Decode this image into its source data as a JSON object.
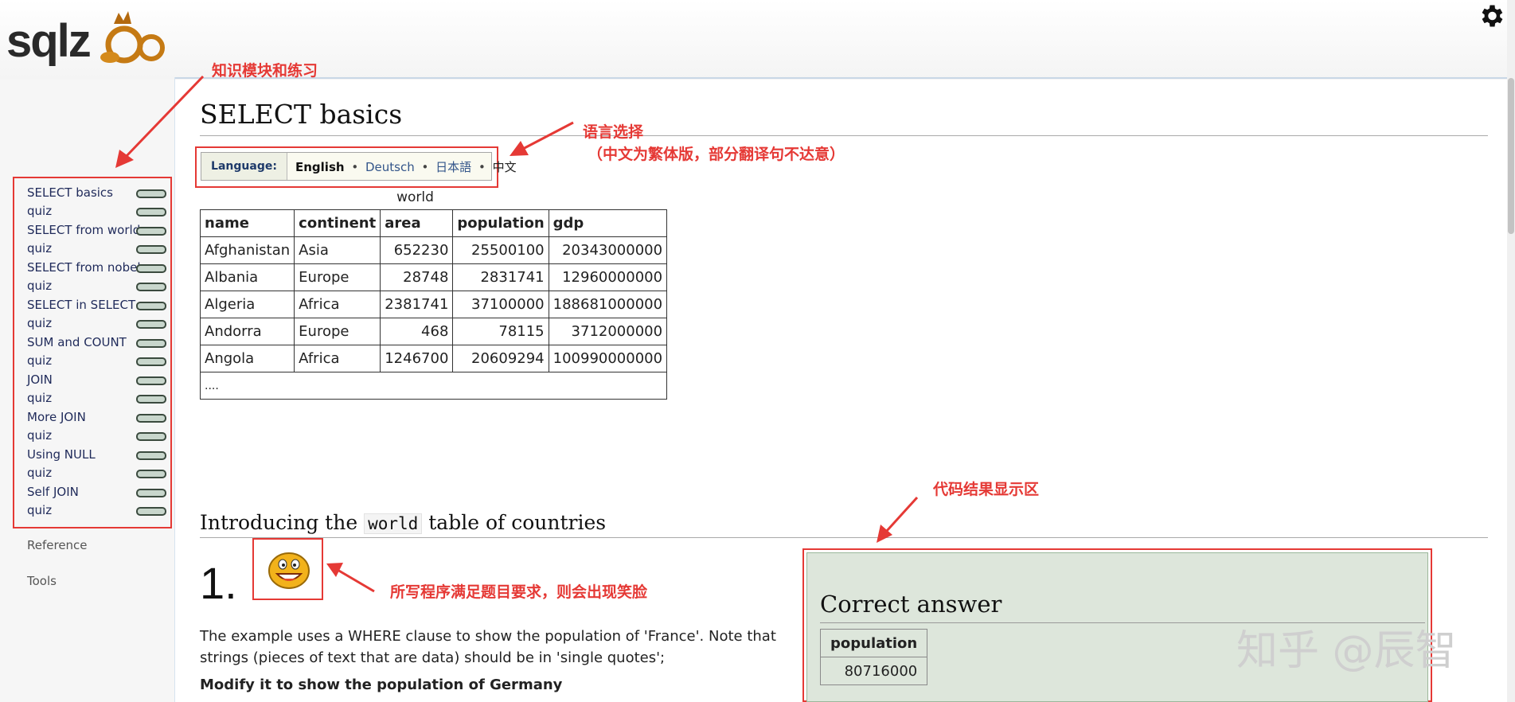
{
  "header": {
    "logo_text": "sqlz",
    "settings_icon": "gear-icon"
  },
  "sidebar": {
    "items": [
      {
        "label": "SELECT basics"
      },
      {
        "label": "quiz"
      },
      {
        "label": "SELECT from world"
      },
      {
        "label": "quiz"
      },
      {
        "label": "SELECT from nobel"
      },
      {
        "label": "quiz"
      },
      {
        "label": "SELECT in SELECT"
      },
      {
        "label": "quiz"
      },
      {
        "label": "SUM and COUNT"
      },
      {
        "label": "quiz"
      },
      {
        "label": "JOIN"
      },
      {
        "label": "quiz"
      },
      {
        "label": "More JOIN"
      },
      {
        "label": "quiz"
      },
      {
        "label": "Using NULL"
      },
      {
        "label": "quiz"
      },
      {
        "label": "Self JOIN"
      },
      {
        "label": "quiz"
      }
    ],
    "reference": "Reference",
    "tools": "Tools"
  },
  "main": {
    "title": "SELECT basics",
    "language": {
      "label": "Language:",
      "current": "English",
      "options": [
        "Deutsch",
        "日本語",
        "中文"
      ]
    },
    "table": {
      "caption": "world",
      "columns": [
        "name",
        "continent",
        "area",
        "population",
        "gdp"
      ],
      "rows": [
        [
          "Afghanistan",
          "Asia",
          "652230",
          "25500100",
          "20343000000"
        ],
        [
          "Albania",
          "Europe",
          "28748",
          "2831741",
          "12960000000"
        ],
        [
          "Algeria",
          "Africa",
          "2381741",
          "37100000",
          "188681000000"
        ],
        [
          "Andorra",
          "Europe",
          "468",
          "78115",
          "3712000000"
        ],
        [
          "Angola",
          "Africa",
          "1246700",
          "20609294",
          "100990000000"
        ]
      ],
      "ellipsis": "...."
    },
    "intro": {
      "before": "Introducing the",
      "code": "world",
      "after": "table of countries"
    },
    "question_number": "1.",
    "description": "The example uses a WHERE clause to show the population of 'France'. Note that strings (pieces of text that are data) should be in 'single quotes';",
    "task": "Modify it to show the population of Germany",
    "answer": {
      "title": "Correct answer",
      "column": "population",
      "value": "80716000"
    }
  },
  "annotations": {
    "nav": "知识模块和练习",
    "lang_line1": "语言选择",
    "lang_line2": "（中文为繁体版，部分翻译句不达意）",
    "result": "代码结果显示区",
    "smiley": "所写程序满足题目要求，则会出现笑脸"
  },
  "watermark": "知乎 @辰智",
  "colors": {
    "annotation": "#e53935",
    "answer_bg": "#dde6db",
    "link": "#33558a"
  }
}
